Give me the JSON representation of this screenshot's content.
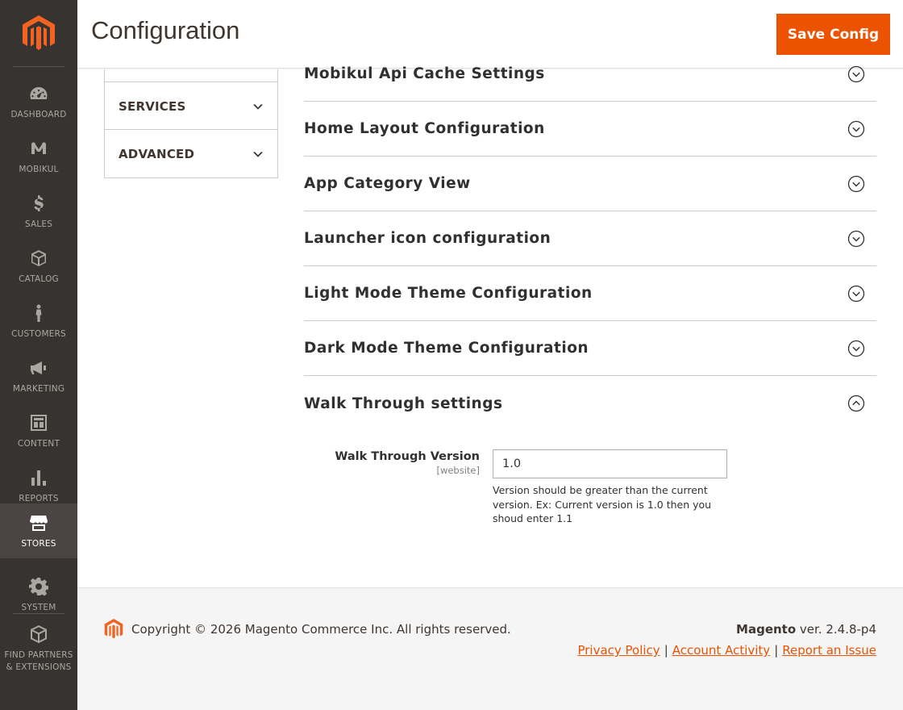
{
  "colors": {
    "sidebar_bg": "#373330",
    "accent": "#eb5202",
    "text": "#303030"
  },
  "sidebar": {
    "logo_icon": "magento-logo-icon",
    "items": [
      {
        "label": "DASHBOARD",
        "icon": "dashboard-gauge-icon"
      },
      {
        "label": "MOBIKUL",
        "icon": "mobikul-icon"
      },
      {
        "label": "SALES",
        "icon": "dollar-icon"
      },
      {
        "label": "CATALOG",
        "icon": "box-icon"
      },
      {
        "label": "CUSTOMERS",
        "icon": "person-icon"
      },
      {
        "label": "MARKETING",
        "icon": "megaphone-icon"
      },
      {
        "label": "CONTENT",
        "icon": "layout-icon"
      },
      {
        "label": "REPORTS",
        "icon": "bar-chart-icon"
      },
      {
        "label": "STORES",
        "icon": "storefront-icon",
        "active": true
      },
      {
        "label": "SYSTEM",
        "icon": "gear-icon"
      },
      {
        "label": "FIND PARTNERS & EXTENSIONS",
        "icon": "extensions-box-icon"
      }
    ]
  },
  "header": {
    "title": "Configuration",
    "save_label": "Save Config"
  },
  "tabs": [
    {
      "label": "SERVICES"
    },
    {
      "label": "ADVANCED"
    }
  ],
  "sections": [
    {
      "title": "Mobikul Api Cache Settings",
      "expanded": false
    },
    {
      "title": "Home Layout Configuration",
      "expanded": false
    },
    {
      "title": "App Category View",
      "expanded": false
    },
    {
      "title": "Launcher icon configuration",
      "expanded": false
    },
    {
      "title": "Light Mode Theme Configuration",
      "expanded": false
    },
    {
      "title": "Dark Mode Theme Configuration",
      "expanded": false
    },
    {
      "title": "Walk Through settings",
      "expanded": true
    }
  ],
  "walkthrough": {
    "field_label": "Walk Through Version",
    "field_scope": "[website]",
    "field_value": "1.0",
    "note": "Version should be greater than the current version. Ex: Current version is 1.0 then you shoud enter 1.1"
  },
  "footer": {
    "copyright": "Copyright © 2026 Magento Commerce Inc. All rights reserved.",
    "brand": "Magento",
    "version": " ver. 2.4.8-p4",
    "links": [
      "Privacy Policy",
      "Account Activity",
      "Report an Issue"
    ],
    "separator": "|"
  }
}
